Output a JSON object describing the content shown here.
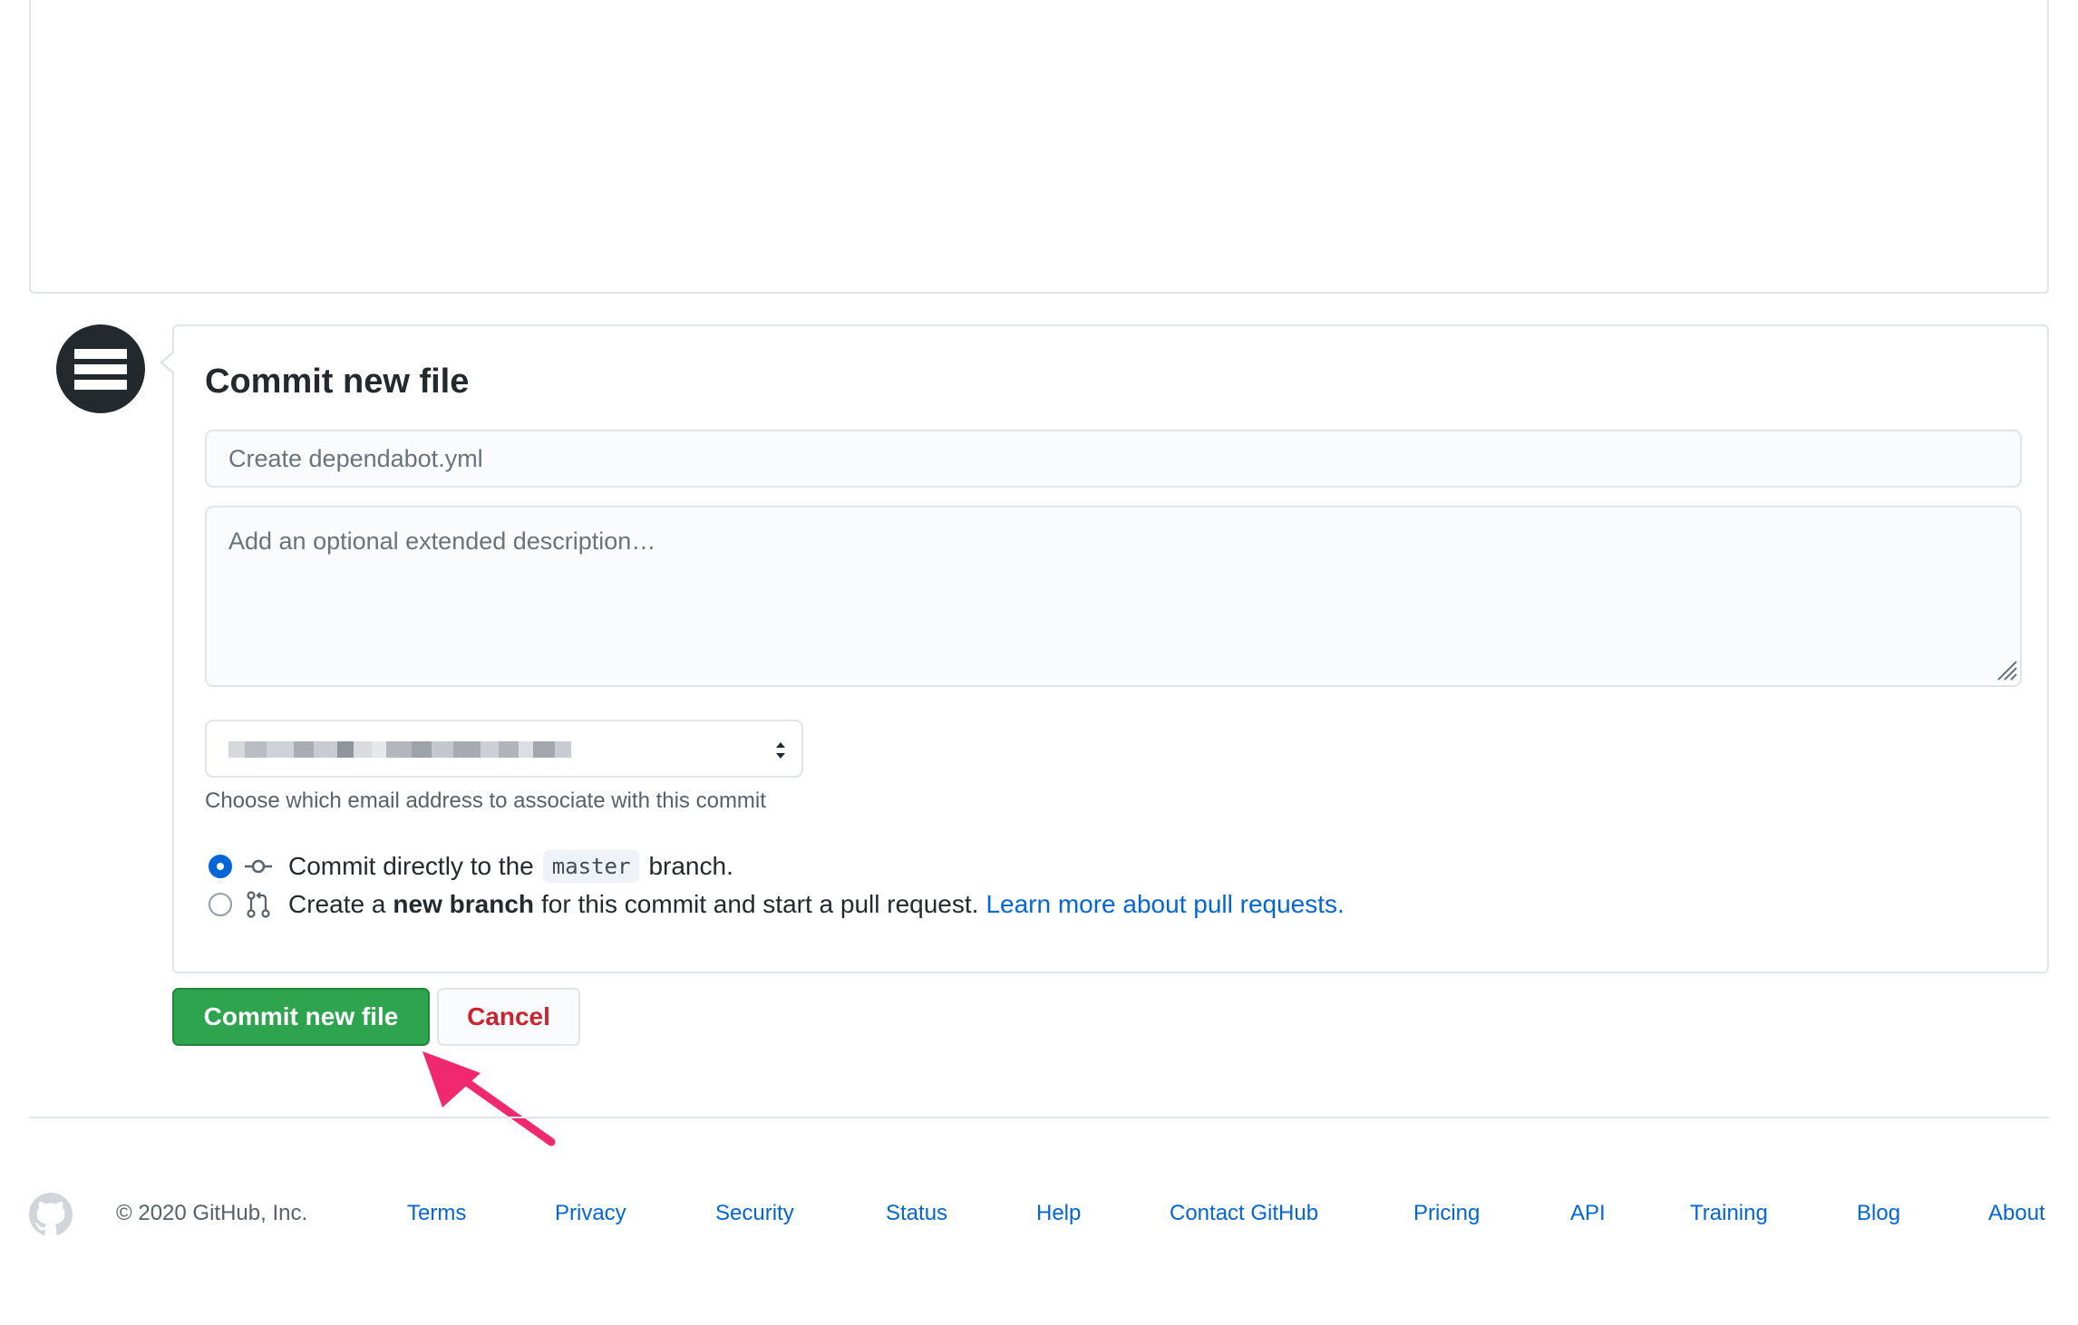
{
  "commit": {
    "title": "Commit new file",
    "summary_placeholder": "Create dependabot.yml",
    "description_placeholder": "Add an optional extended description…",
    "email_note": "Choose which email address to associate with this commit",
    "option_direct": {
      "prefix": "Commit directly to the",
      "branch": "master",
      "suffix": "branch."
    },
    "option_new_branch": {
      "prefix": "Create a",
      "bold": "new branch",
      "middle": "for this commit and start a pull request.",
      "link": "Learn more about pull requests."
    }
  },
  "buttons": {
    "commit": "Commit new file",
    "cancel": "Cancel"
  },
  "footer": {
    "copyright": "© 2020 GitHub, Inc.",
    "links": [
      "Terms",
      "Privacy",
      "Security",
      "Status",
      "Help",
      "Contact GitHub",
      "Pricing",
      "API",
      "Training",
      "Blog",
      "About"
    ]
  },
  "colors": {
    "primary_button": "#2ea44f",
    "cancel_text": "#cb2431",
    "link": "#0366d6",
    "annotation_arrow": "#f0286e"
  },
  "icons": {
    "avatar": "hamburger-avatar-icon",
    "commit": "git-commit-icon",
    "pull_request": "git-pull-request-icon",
    "footer_logo": "github-mark-icon",
    "select": "select-arrows-icon"
  }
}
